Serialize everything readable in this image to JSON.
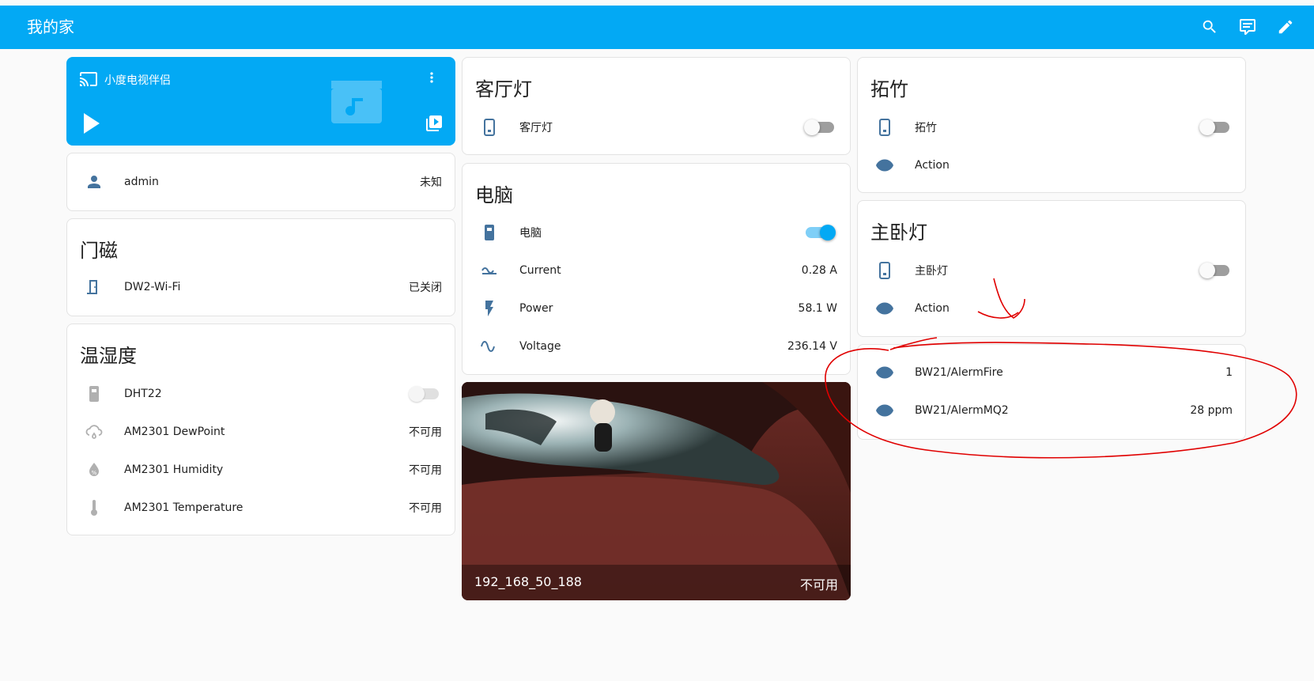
{
  "header": {
    "title": "我的家"
  },
  "media": {
    "name": "小度电视伴侣"
  },
  "person": {
    "name": "admin",
    "state": "未知"
  },
  "door": {
    "title": "门磁",
    "entity": "DW2-Wi-Fi",
    "state": "已关闭"
  },
  "climate": {
    "title": "温湿度",
    "rows": [
      {
        "name": "DHT22",
        "state": ""
      },
      {
        "name": "AM2301 DewPoint",
        "state": "不可用"
      },
      {
        "name": "AM2301 Humidity",
        "state": "不可用"
      },
      {
        "name": "AM2301 Temperature",
        "state": "不可用"
      }
    ]
  },
  "living_light": {
    "title": "客厅灯",
    "entity": "客厅灯"
  },
  "computer": {
    "title": "电脑",
    "rows": [
      {
        "name": "电脑",
        "state": ""
      },
      {
        "name": "Current",
        "state": "0.28 A"
      },
      {
        "name": "Power",
        "state": "58.1 W"
      },
      {
        "name": "Voltage",
        "state": "236.14 V"
      }
    ]
  },
  "camera": {
    "name": "192_168_50_188",
    "state": "不可用"
  },
  "tuozhu": {
    "title": "拓竹",
    "entity": "拓竹",
    "action": "Action"
  },
  "master_light": {
    "title": "主卧灯",
    "entity": "主卧灯",
    "action": "Action"
  },
  "bw21": {
    "rows": [
      {
        "name": "BW21/AlermFire",
        "state": "1"
      },
      {
        "name": "BW21/AlermMQ2",
        "state": "28 ppm"
      }
    ]
  },
  "colors": {
    "primary": "#03a9f4",
    "icon": "#44739e",
    "annotation": "#e00000"
  }
}
